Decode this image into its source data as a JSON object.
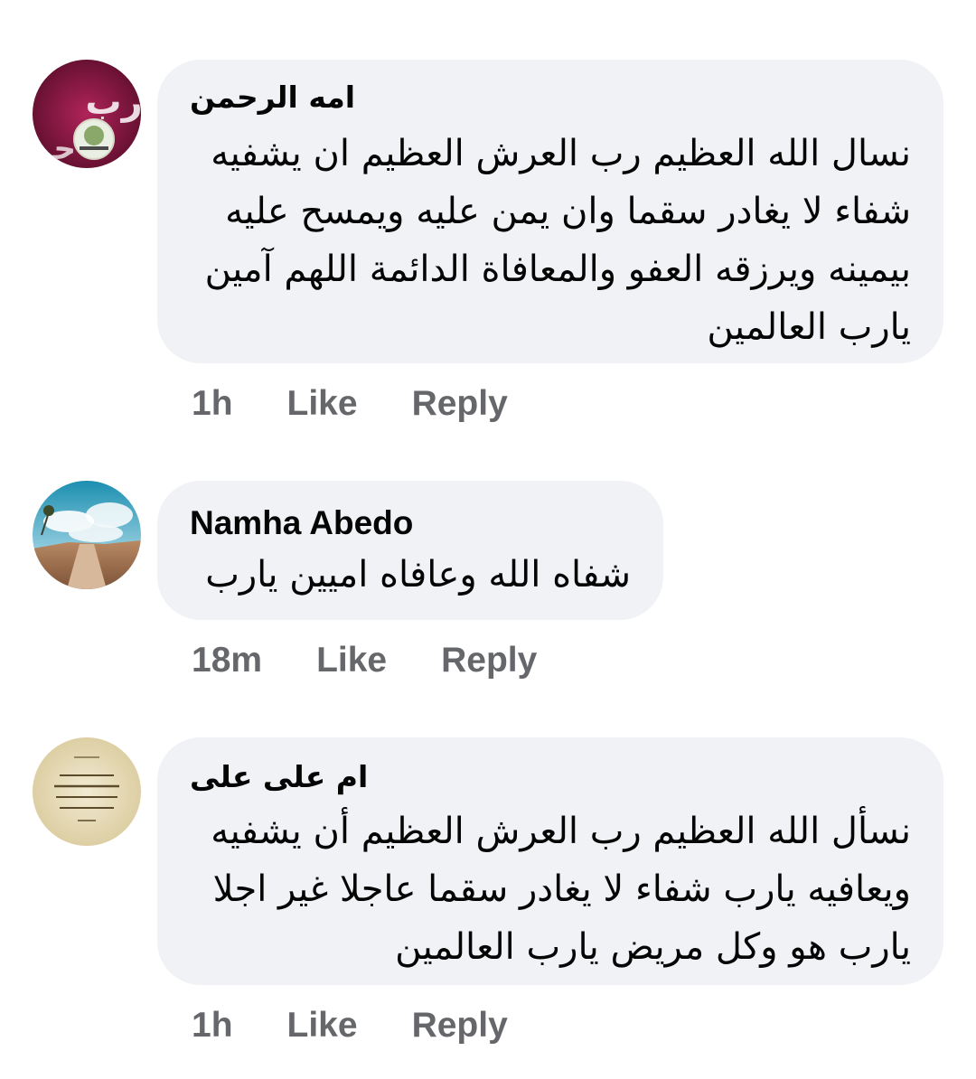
{
  "comments": [
    {
      "author": "امه الرحمن",
      "text": "نسال الله العظيم رب العرش العظيم ان يشفيه شفاء لا يغادر سقما وان يمن عليه ويمسح عليه بيمينه ويرزقه العفو والمعافاة الدائمة اللهم آمين يارب العالمين",
      "time": "1h",
      "like_label": "Like",
      "reply_label": "Reply"
    },
    {
      "author": "Namha Abedo",
      "text": "شفاه الله وعافاه امیین یارب",
      "time": "18m",
      "like_label": "Like",
      "reply_label": "Reply"
    },
    {
      "author": "ام على على",
      "text": "نسأل الله العظيم رب العرش العظيم أن يشفيه ويعافيه يارب شفاء لا يغادر سقما عاجلا غير اجلا يارب هو وكل مريض يارب العالمين",
      "time": "1h",
      "like_label": "Like",
      "reply_label": "Reply"
    }
  ],
  "colors": {
    "bubble": "#f0f2f5",
    "text": "#050505",
    "meta": "#65676b"
  }
}
